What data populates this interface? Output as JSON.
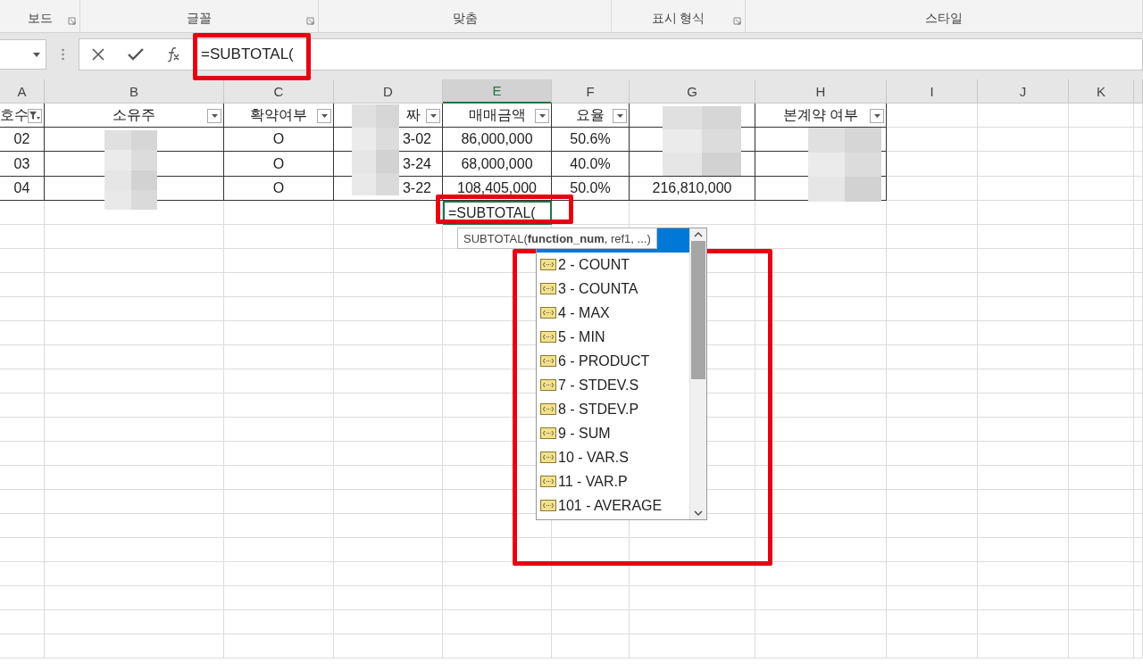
{
  "ribbon_groups": [
    {
      "label": "보드",
      "launcher": true
    },
    {
      "label": "글꼴",
      "launcher": true
    },
    {
      "label": "맞춤",
      "launcher": false
    },
    {
      "label": "표시 형식",
      "launcher": true
    },
    {
      "label": "스타일",
      "launcher": false
    }
  ],
  "formula_bar": {
    "text": "=SUBTOTAL(",
    "highlighted": true
  },
  "columns": [
    {
      "letter": "A",
      "selected": false
    },
    {
      "letter": "B",
      "selected": false
    },
    {
      "letter": "C",
      "selected": false
    },
    {
      "letter": "D",
      "selected": false
    },
    {
      "letter": "E",
      "selected": true
    },
    {
      "letter": "F",
      "selected": false
    },
    {
      "letter": "G",
      "selected": false
    },
    {
      "letter": "H",
      "selected": false
    },
    {
      "letter": "I",
      "selected": false
    },
    {
      "letter": "J",
      "selected": false
    },
    {
      "letter": "K",
      "selected": false
    }
  ],
  "table_headers": [
    {
      "kind": "header",
      "text": "호수",
      "filtered": true
    },
    {
      "kind": "header",
      "text": "소유주",
      "filtered": false
    },
    {
      "kind": "header",
      "text": "확약여부",
      "filtered": false
    },
    {
      "kind": "header",
      "text": "짜",
      "filtered": false
    },
    {
      "kind": "header",
      "text": "매매금액",
      "filtered": false
    },
    {
      "kind": "header",
      "text": "요율",
      "filtered": false
    },
    {
      "kind": "blank"
    },
    {
      "kind": "header",
      "text": "본계약 여부",
      "filtered": false
    }
  ],
  "rows": [
    {
      "cells": [
        "02",
        null,
        "O",
        "3-02",
        "86,000,000",
        "50.6%",
        null,
        null
      ]
    },
    {
      "cells": [
        "03",
        null,
        "O",
        "3-24",
        "68,000,000",
        "40.0%",
        null,
        null
      ]
    },
    {
      "cells": [
        "04",
        null,
        "O",
        "3-22",
        "108,405,000",
        "50.0%",
        "216,810,000",
        null
      ]
    }
  ],
  "active_cell": {
    "text": "=SUBTOTAL(",
    "highlighted": true
  },
  "tooltip": {
    "text": "SUBTOTAL(**function_num**, ref1, ...)"
  },
  "autocomplete": {
    "highlighted": true,
    "items": [
      {
        "selected": true
      },
      {
        "label": "2 - COUNT",
        "selected": false
      },
      {
        "label": "3 - COUNTA",
        "selected": false
      },
      {
        "label": "4 - MAX",
        "selected": false
      },
      {
        "label": "5 - MIN",
        "selected": false
      },
      {
        "label": "6 - PRODUCT",
        "selected": false
      },
      {
        "label": "7 - STDEV.S",
        "selected": false
      },
      {
        "label": "8 - STDEV.P",
        "selected": false
      },
      {
        "label": "9 - SUM",
        "selected": false
      },
      {
        "label": "10 - VAR.S",
        "selected": false
      },
      {
        "label": "11 - VAR.P",
        "selected": false
      },
      {
        "label": "101 - AVERAGE",
        "selected": false
      }
    ]
  }
}
